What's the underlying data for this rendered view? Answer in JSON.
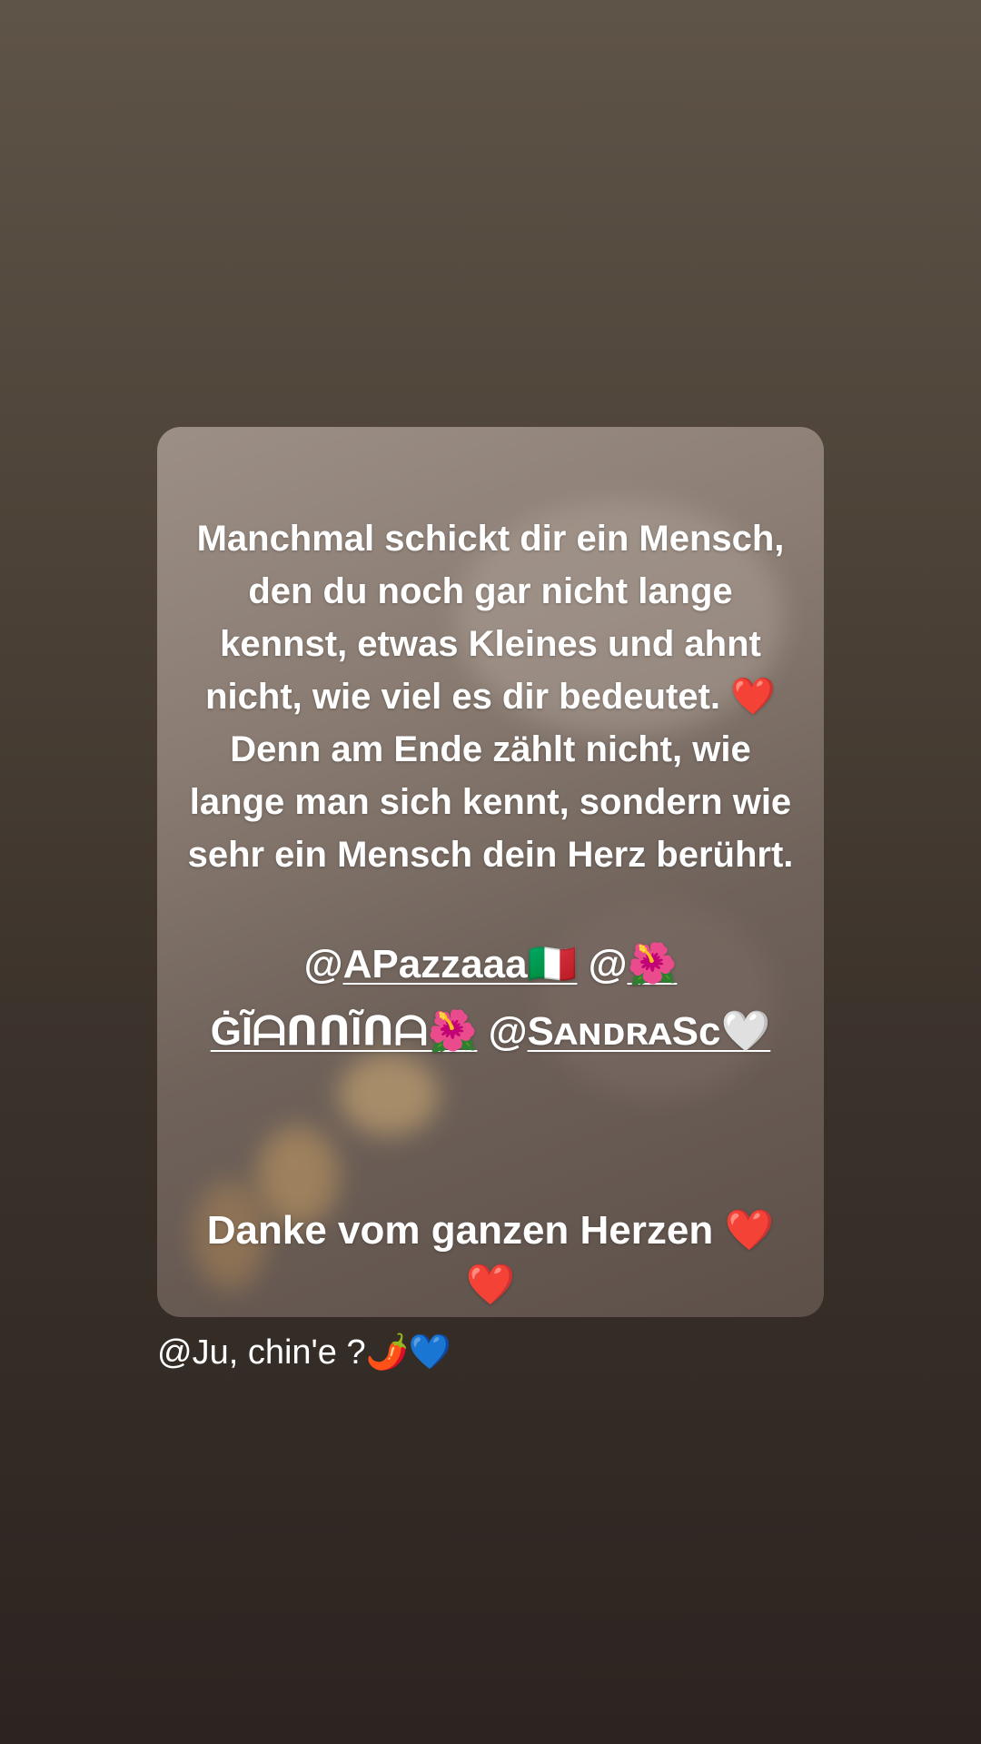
{
  "story": {
    "quote_lines": [
      "Manchmal schickt dir ein Mensch,",
      "den du noch gar nicht lange",
      "kennst, etwas Kleines und ahnt",
      "nicht, wie viel es dir bedeutet. ❤️",
      "Denn am Ende zählt nicht, wie",
      "lange man sich kennt, sondern wie",
      "sehr ein Mensch dein Herz berührt."
    ],
    "mentions": {
      "row1": {
        "m1_at": "@",
        "m1_name": "APazzaaa🇮🇹",
        "m2_at": "@",
        "m2_name": "🌺"
      },
      "row2": {
        "m2_name_cont": "ĠĨᗩᑎᑎĨᑎᗩ🌺",
        "m3_at": "@",
        "m3_name": "SᴀɴᴅʀᴀSᴄ🤍"
      }
    },
    "thanks_lines": [
      "Danke vom ganzen Herzen ❤️",
      "❤️"
    ],
    "user_caption": "@Ju, chin'e ?🌶️💙"
  }
}
